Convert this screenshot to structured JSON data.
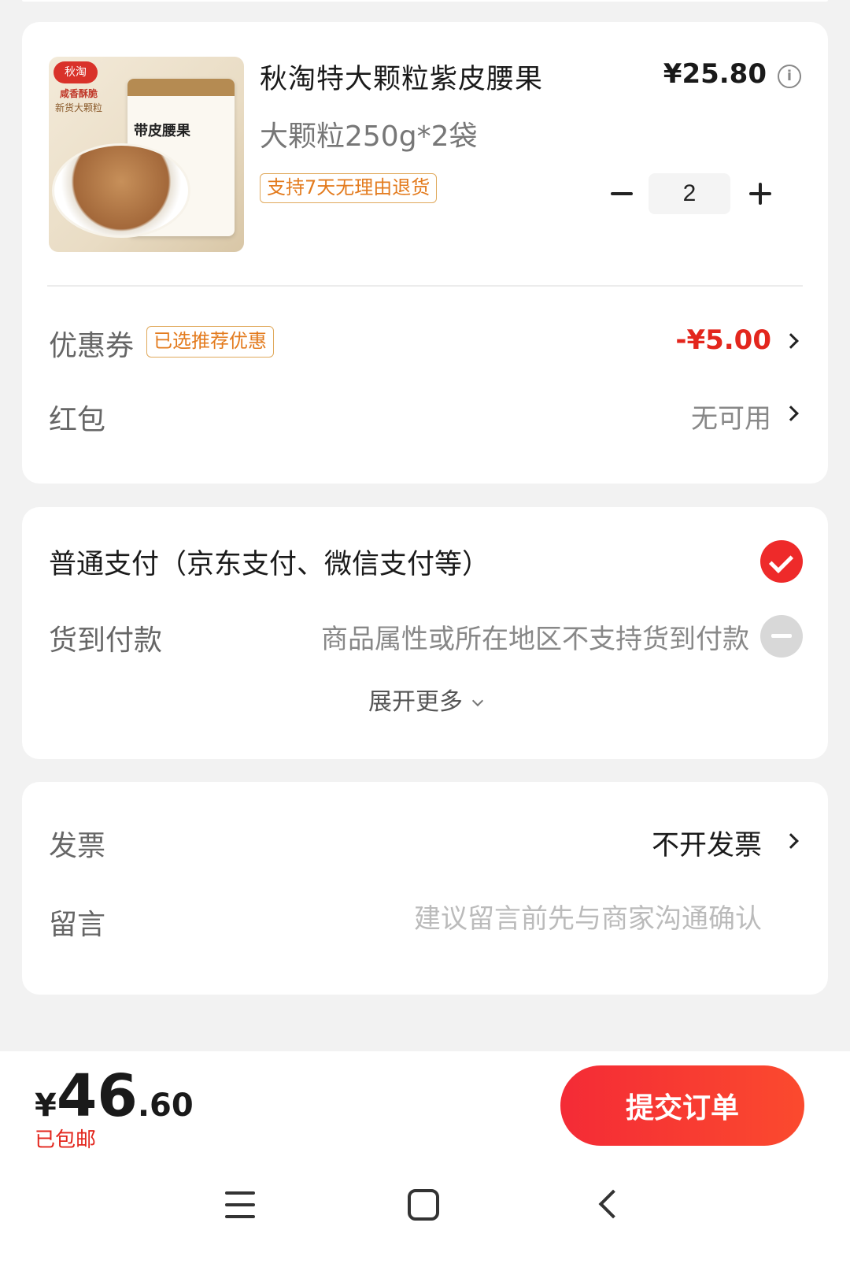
{
  "product": {
    "image_brand": "秋淘",
    "image_tag1": "咸香酥脆",
    "image_tag2": "新货大颗粒",
    "image_bag_title": "带皮腰果",
    "title": "秋淘特大颗粒紫皮腰果",
    "price": "¥25.80",
    "spec": "大颗粒250g*2袋",
    "return_tag": "支持7天无理由退货",
    "quantity": "2"
  },
  "coupon": {
    "label": "优惠券",
    "badge": "已选推荐优惠",
    "value": "-¥5.00"
  },
  "red_packet": {
    "label": "红包",
    "value": "无可用"
  },
  "payment": {
    "normal_label": "普通支付（京东支付、微信支付等）",
    "cod_label": "货到付款",
    "cod_note": "商品属性或所在地区不支持货到付款",
    "expand_more": "展开更多"
  },
  "invoice": {
    "label": "发票",
    "value": "不开发票"
  },
  "message": {
    "label": "留言",
    "placeholder": "建议留言前先与商家沟通确认"
  },
  "bottom": {
    "currency": "¥",
    "total_int": "46",
    "total_dec": ".60",
    "shipping": "已包邮",
    "submit": "提交订单"
  },
  "colors": {
    "accent_red": "#e3261d",
    "button_red": "#f42b36",
    "tag_orange": "#e37b1e"
  },
  "icons": [
    "info-icon",
    "check-icon",
    "disabled-icon",
    "chevron-right-icon",
    "chevron-down-icon",
    "menu-icon",
    "home-icon",
    "back-icon"
  ]
}
